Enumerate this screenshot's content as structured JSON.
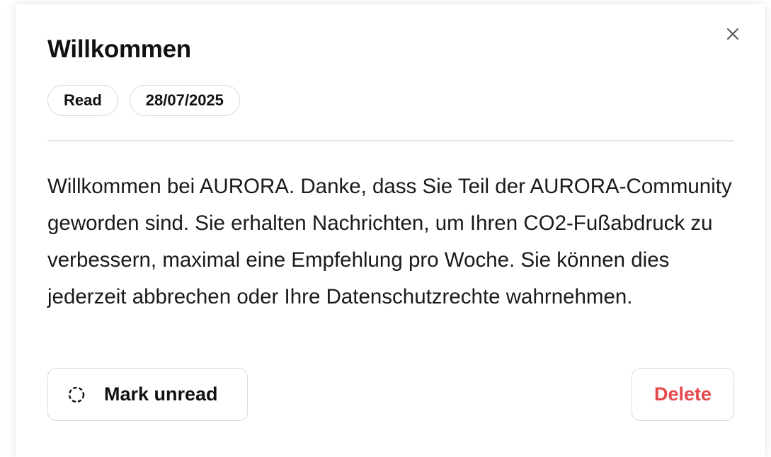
{
  "dialog": {
    "title": "Willkommen",
    "close_icon": "close-icon",
    "badges": [
      {
        "label": "Read"
      },
      {
        "label": "28/07/2025"
      }
    ],
    "message": "Willkommen bei AURORA. Danke, dass Sie Teil der AURORA-Community geworden sind. Sie erhalten Nachrichten, um Ihren CO2-Fußabdruck zu verbessern, maximal eine Empfehlung pro Woche. Sie können dies jederzeit abbrechen oder Ihre Datenschutzrechte wahrnehmen.",
    "actions": {
      "mark_unread_label": "Mark unread",
      "mark_unread_icon": "dashed-circle-icon",
      "delete_label": "Delete"
    }
  },
  "colors": {
    "delete": "#e5484d",
    "text": "#111111",
    "border": "#dcdcdc"
  }
}
